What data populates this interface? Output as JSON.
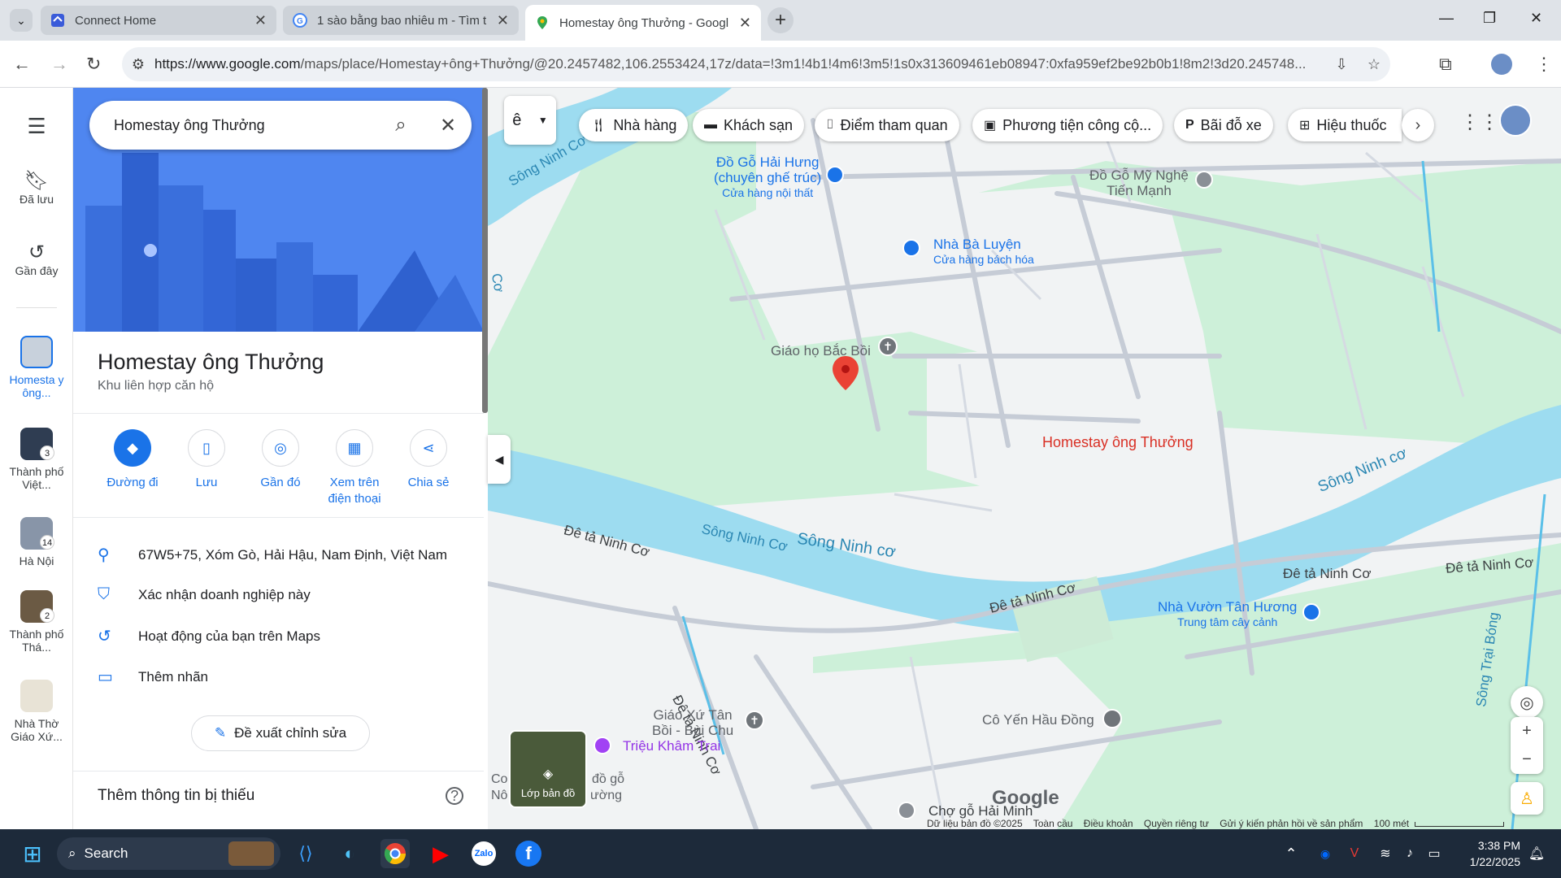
{
  "browser": {
    "tabs": [
      {
        "title": "Connect Home",
        "favicon": "connect-icon"
      },
      {
        "title": "1 sào bằng bao nhiêu m - Tìm t",
        "favicon": "google-icon"
      },
      {
        "title": "Homestay ông Thưởng - Googl",
        "favicon": "maps-icon"
      }
    ],
    "url_domain": "https://www.google.com",
    "url_path": "/maps/place/Homestay+ông+Thưởng/@20.2457482,106.2553424,17z/data=!3m1!4b1!4m6!3m5!1s0x313609461eb08947:0xfa959ef2be92b0b1!8m2!3d20.245748..."
  },
  "sidenav": {
    "saved": "Đã lưu",
    "recent": "Gần đây",
    "history": [
      {
        "label": "Homesta y ông...",
        "badge": ""
      },
      {
        "label": "Thành phố Việt...",
        "badge": "3"
      },
      {
        "label": "Hà Nội",
        "badge": "14"
      },
      {
        "label": "Thành phố Thá...",
        "badge": "2"
      },
      {
        "label": "Nhà Thờ Giáo Xứ...",
        "badge": ""
      }
    ]
  },
  "search": {
    "query": "Homestay ông Thưởng"
  },
  "place": {
    "name": "Homestay ông Thưởng",
    "category": "Khu liên hợp căn hộ",
    "actions": {
      "directions": "Đường đi",
      "save": "Lưu",
      "nearby": "Gần đó",
      "phone": "Xem trên điện thoại",
      "share": "Chia sẻ"
    },
    "address": "67W5+75, Xóm Gò, Hải Hậu, Nam Định, Việt Nam",
    "claim": "Xác nhận doanh nghiệp này",
    "activity": "Hoạt động của bạn trên Maps",
    "label": "Thêm nhãn",
    "suggest_edit": "Đề xuất chỉnh sửa",
    "missing_info": "Thêm thông tin bị thiếu"
  },
  "map": {
    "chips": [
      "Nhà hàng",
      "Khách sạn",
      "Điểm tham quan",
      "Phương tiện công cộ...",
      "Bãi đỗ xe",
      "Hiệu thuốc"
    ],
    "input_tool": "ê",
    "pin_label": "Homestay ông Thưởng",
    "labels": {
      "poi1_a": "Đồ Gỗ Hải Hưng",
      "poi1_b": "(chuyên ghế trúc)",
      "poi1_sub": "Cửa hàng nội thất",
      "poi2_a": "Đồ Gỗ Mỹ Nghệ",
      "poi2_b": "Tiến Mạnh",
      "poi3": "Nhà Bà Luyện",
      "poi3_sub": "Cửa hàng bách hóa",
      "church1": "Giáo họ Bắc Bồi",
      "river1": "Sông Ninh Cơ",
      "river2": "Sông Ninh cơ",
      "river3": "Sông Ninh cơ",
      "river_tl": "Sông Ninh Cơ",
      "river_tl2": "Cơ",
      "road1": "Đê tả Ninh Cơ",
      "road2": "Đê tả Ninh Cơ",
      "road3": "Đê tả Ninh Cơ",
      "road4": "Đê tả Ninh Cơ",
      "road5": "Đê tả Ninh Cơ",
      "river_v": "Sông Trại Bóng",
      "poi4": "Nhà Vườn Tân Hương",
      "poi4_sub": "Trung tâm cây cảnh",
      "church2_a": "Giáo Xứ Tân",
      "church2_b": "Bồi - Bùi Chu",
      "poi5": "Triệu Khâm Trai",
      "poi6": "Cô Yến Hầu Đồng",
      "poi7": "Chợ gỗ Hải Minh",
      "partial1": "Co",
      "partial2": "Nô",
      "partial3": "đồ gỗ",
      "partial4": "ường"
    },
    "layers_label": "Lớp bản đồ",
    "logo": "Google",
    "footer": [
      "Dữ liệu bản đồ ©2025",
      "Toàn cầu",
      "Điều khoản",
      "Quyền riêng tư",
      "Gửi ý kiến phản hồi về sản phẩm",
      "100 mét"
    ]
  },
  "taskbar": {
    "search": "Search",
    "time": "3:38 PM",
    "date": "1/22/2025"
  },
  "colors": {
    "accent": "#1a73e8",
    "water": "#9ddcf0",
    "park": "#c9f0d4",
    "pin": "#ea4335"
  }
}
